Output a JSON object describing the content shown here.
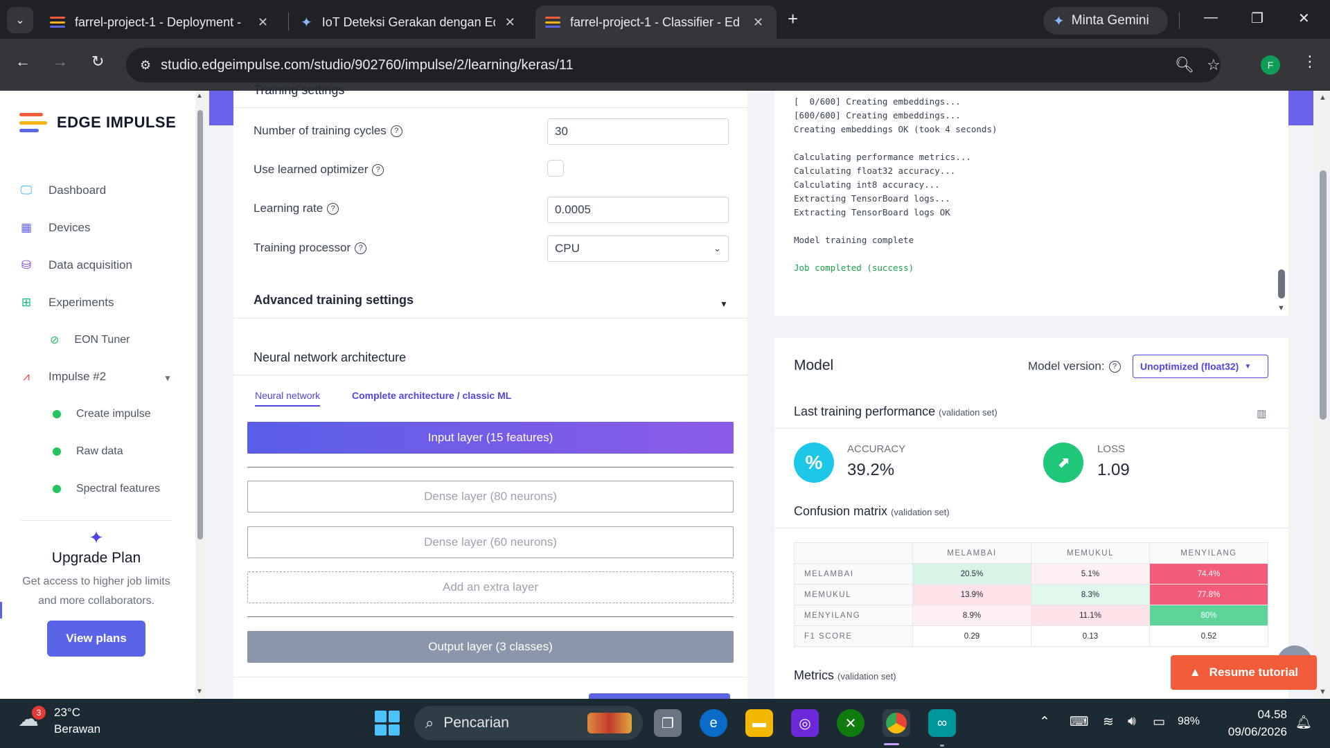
{
  "browser": {
    "tabs": [
      {
        "title": "farrel-project-1 - Deployment -"
      },
      {
        "title": "IoT Deteksi Gerakan dengan Ed"
      },
      {
        "title": "farrel-project-1 - Classifier - Ed"
      }
    ],
    "gemini_label": "Minta Gemini",
    "url": "studio.edgeimpulse.com/studio/902760/impulse/2/learning/keras/11",
    "profile_initial": "F"
  },
  "sidebar": {
    "logo": "EDGE IMPULSE",
    "items": [
      {
        "label": "Dashboard",
        "icon": "monitor-icon"
      },
      {
        "label": "Devices",
        "icon": "chip-icon"
      },
      {
        "label": "Data acquisition",
        "icon": "database-icon"
      },
      {
        "label": "Experiments",
        "icon": "table-icon"
      },
      {
        "label": "EON Tuner",
        "icon": "compass-icon"
      },
      {
        "label": "Impulse #2",
        "icon": "pulse-icon"
      },
      {
        "label": "Create impulse"
      },
      {
        "label": "Raw data"
      },
      {
        "label": "Spectral features"
      }
    ],
    "upgrade": {
      "title": "Upgrade Plan",
      "text": "Get access to higher job limits and more collaborators.",
      "button": "View plans"
    }
  },
  "training": {
    "header": "Training settings",
    "cycles_label": "Number of training cycles",
    "cycles_value": "30",
    "optimizer_label": "Use learned optimizer",
    "lr_label": "Learning rate",
    "lr_value": "0.0005",
    "processor_label": "Training processor",
    "processor_value": "CPU",
    "advanced_label": "Advanced training settings"
  },
  "architecture": {
    "title": "Neural network architecture",
    "tabs": [
      "Neural network",
      "Complete architecture / classic ML"
    ],
    "layers": {
      "input": "Input layer (15 features)",
      "dense1": "Dense layer (80 neurons)",
      "dense2": "Dense layer (60 neurons)",
      "extra": "Add an extra layer",
      "output": "Output layer (3 classes)"
    }
  },
  "log": {
    "lines": [
      "[  0/600] Creating embeddings...",
      "[600/600] Creating embeddings...",
      "Creating embeddings OK (took 4 seconds)",
      "",
      "Calculating performance metrics...",
      "Calculating float32 accuracy...",
      "Calculating int8 accuracy...",
      "Extracting TensorBoard logs...",
      "Extracting TensorBoard logs OK",
      "",
      "Model training complete",
      "",
      "Job completed (success)"
    ]
  },
  "model": {
    "title": "Model",
    "version_label": "Model version:",
    "version_value": "Unoptimized (float32)",
    "last_perf": "Last training performance",
    "validation_set": "(validation set)",
    "accuracy_label": "ACCURACY",
    "accuracy_value": "39.2%",
    "loss_label": "LOSS",
    "loss_value": "1.09",
    "confusion_title": "Confusion matrix",
    "metrics_title": "Metrics",
    "confusion": {
      "columns": [
        "MELAMBAI",
        "MEMUKUL",
        "MENYILANG"
      ],
      "rows": [
        {
          "label": "MELAMBAI",
          "values": [
            "20.5%",
            "5.1%",
            "74.4%"
          ]
        },
        {
          "label": "MEMUKUL",
          "values": [
            "13.9%",
            "8.3%",
            "77.8%"
          ]
        },
        {
          "label": "MENYILANG",
          "values": [
            "8.9%",
            "11.1%",
            "80%"
          ]
        },
        {
          "label": "F1 SCORE",
          "values": [
            "0.29",
            "0.13",
            "0.52"
          ]
        }
      ],
      "colors": {
        "good_strong": "#5cd49a",
        "good_light": "#d7f5e6",
        "bad_strong": "#f25c7a",
        "bad_light": "#fde2e8",
        "bad_faint": "#fff0f3"
      }
    }
  },
  "resume_tutorial": "Resume tutorial",
  "taskbar": {
    "temperature": "23°C",
    "weather": "Berawan",
    "weather_badge": "3",
    "search_placeholder": "Pencarian",
    "battery": "98%",
    "time": "04.58",
    "date": "09/06/2026"
  }
}
